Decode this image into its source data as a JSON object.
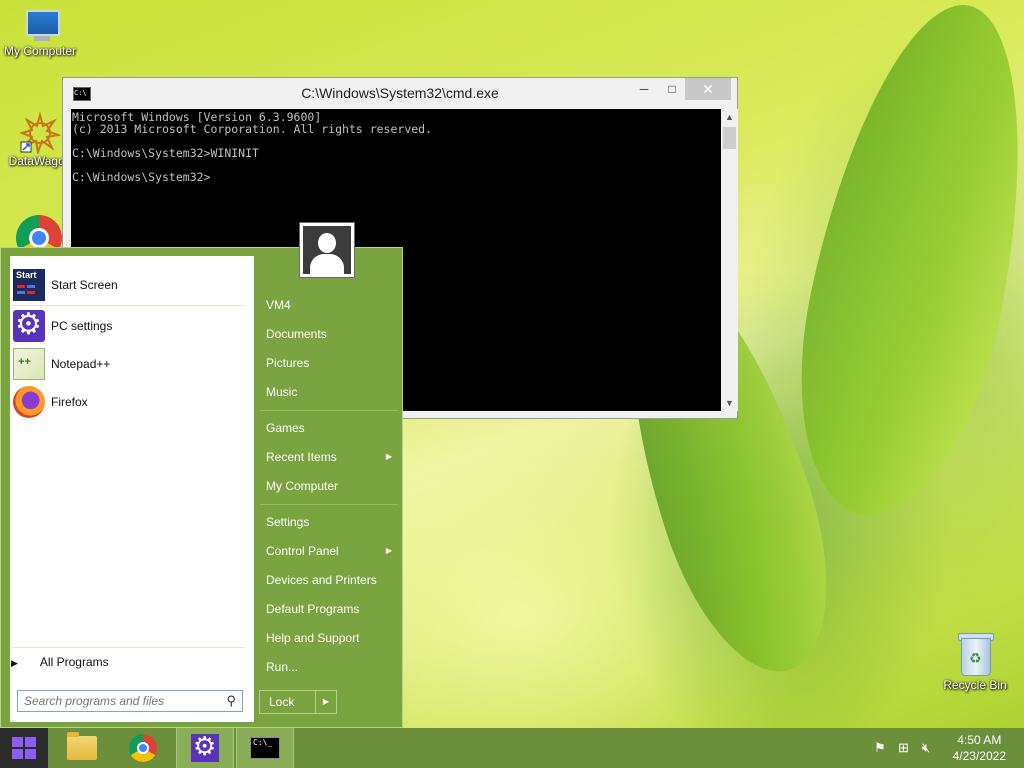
{
  "desktop": {
    "icons": [
      {
        "label": "My Computer"
      },
      {
        "label": "DataWagon"
      },
      {
        "label": "Recycle Bin"
      }
    ]
  },
  "cmd_window": {
    "title": "C:\\Windows\\System32\\cmd.exe",
    "minimize_glyph": "─",
    "maximize_glyph": "□",
    "close_glyph": "✕",
    "app_icon_text": "C:\\",
    "output": "Microsoft Windows [Version 6.3.9600]\n(c) 2013 Microsoft Corporation. All rights reserved.\n\nC:\\Windows\\System32>WININIT\n\nC:\\Windows\\System32>"
  },
  "start_menu": {
    "pinned": [
      {
        "label": "Start Screen",
        "icon": "start-screen-icon",
        "icon_text": "Start"
      },
      {
        "label": "PC settings",
        "icon": "gear-icon"
      },
      {
        "label": "Notepad++",
        "icon": "notepad-plus-plus-icon"
      },
      {
        "label": "Firefox",
        "icon": "firefox-icon"
      }
    ],
    "all_programs": "All Programs",
    "search_placeholder": "Search programs and files",
    "right": {
      "user": "VM4",
      "documents": "Documents",
      "pictures": "Pictures",
      "music": "Music",
      "games": "Games",
      "recent_items": "Recent Items",
      "my_computer": "My Computer",
      "settings": "Settings",
      "control_panel": "Control Panel",
      "devices_printers": "Devices and Printers",
      "default_programs": "Default Programs",
      "help_support": "Help and Support",
      "run": "Run..."
    },
    "lock": "Lock"
  },
  "taskbar": {
    "cmd_icon_text": "C:\\_",
    "clock": {
      "time": "4:50 AM",
      "date": "4/23/2022"
    }
  },
  "colors": {
    "start_menu": "#7aa440",
    "taskbar": "#6b8f3b",
    "start_button_logo": "#8b5cf6"
  }
}
